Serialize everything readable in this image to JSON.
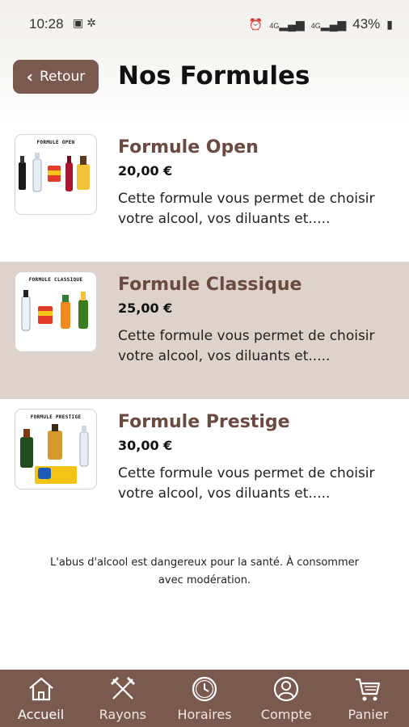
{
  "status_bar": {
    "time": "10:28",
    "battery": "43%",
    "network_1": "4G",
    "network_2": "4G"
  },
  "header": {
    "back_label": "Retour",
    "title": "Nos Formules"
  },
  "formulas": [
    {
      "image_label": "FORMULE OPEN",
      "name": "Formule Open",
      "price": "20,00 €",
      "description": "Cette formule vous permet de choisir votre alcool, vos diluants et.....",
      "highlighted": false
    },
    {
      "image_label": "FORMULE CLASSIQUE",
      "name": "Formule Classique",
      "price": "25,00 €",
      "description": "Cette formule vous permet de choisir votre alcool, vos diluants et.....",
      "highlighted": true
    },
    {
      "image_label": "FORMULE PRESTIGE",
      "name": "Formule Prestige",
      "price": "30,00 €",
      "description": "Cette formule vous permet de choisir votre alcool, vos diluants et.....",
      "highlighted": false
    }
  ],
  "warning": {
    "line1": "L'abus d'alcool est dangereux pour la santé. À consommer",
    "line2": "avec modération."
  },
  "nav": {
    "items": [
      {
        "label": "Accueil",
        "icon": "home-icon",
        "active": true
      },
      {
        "label": "Rayons",
        "icon": "utensils-icon",
        "active": false
      },
      {
        "label": "Horaires",
        "icon": "clock-icon",
        "active": false
      },
      {
        "label": "Compte",
        "icon": "user-icon",
        "active": false
      },
      {
        "label": "Panier",
        "icon": "cart-icon",
        "active": false
      }
    ]
  },
  "colors": {
    "brand_brown": "#7a5a4e",
    "title_brown": "#6b4a3f",
    "highlight_row": "#ddd3cc"
  }
}
